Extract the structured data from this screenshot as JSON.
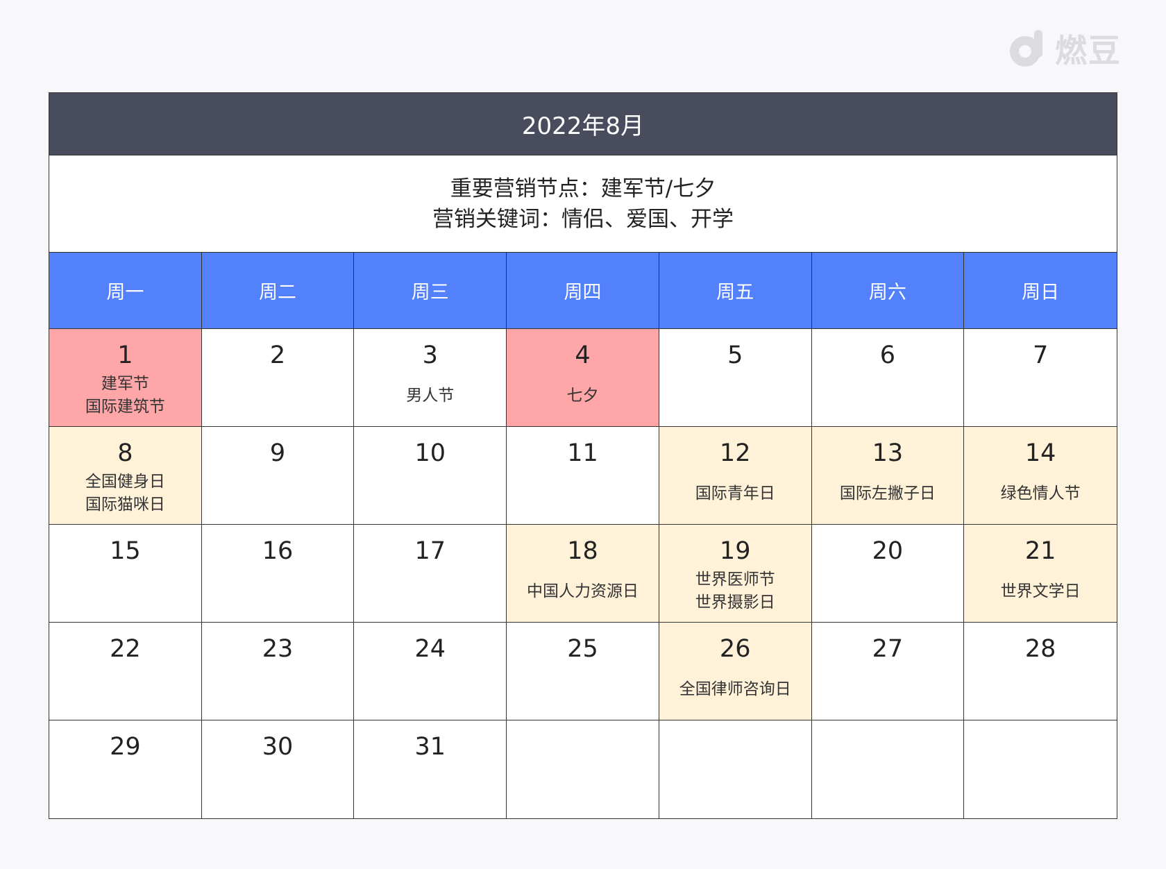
{
  "brand": {
    "name": "燃豆",
    "icon": "brand-d-icon"
  },
  "calendar": {
    "title": "2022年8月",
    "marketing": {
      "line1": "重要营销节点：建军节/七夕",
      "line2": "营销关键词：情侣、爱国、开学"
    },
    "weekdays": [
      "周一",
      "周二",
      "周三",
      "周四",
      "周五",
      "周六",
      "周日"
    ],
    "highlight_colors": {
      "major": "#ffa6a8",
      "minor": "#fff2d9",
      "header": "#494c5d",
      "weekday": "#5381fb"
    },
    "weeks": [
      [
        {
          "day": "1",
          "events": [
            "建军节",
            "国际建筑节"
          ],
          "highlight": "red"
        },
        {
          "day": "2",
          "events": [],
          "highlight": ""
        },
        {
          "day": "3",
          "events": [
            "男人节"
          ],
          "highlight": ""
        },
        {
          "day": "4",
          "events": [
            "七夕"
          ],
          "highlight": "red"
        },
        {
          "day": "5",
          "events": [],
          "highlight": ""
        },
        {
          "day": "6",
          "events": [],
          "highlight": ""
        },
        {
          "day": "7",
          "events": [],
          "highlight": ""
        }
      ],
      [
        {
          "day": "8",
          "events": [
            "全国健身日",
            "国际猫咪日"
          ],
          "highlight": "yellow"
        },
        {
          "day": "9",
          "events": [],
          "highlight": ""
        },
        {
          "day": "10",
          "events": [],
          "highlight": ""
        },
        {
          "day": "11",
          "events": [],
          "highlight": ""
        },
        {
          "day": "12",
          "events": [
            "国际青年日"
          ],
          "highlight": "yellow"
        },
        {
          "day": "13",
          "events": [
            "国际左撇子日"
          ],
          "highlight": "yellow"
        },
        {
          "day": "14",
          "events": [
            "绿色情人节"
          ],
          "highlight": "yellow"
        }
      ],
      [
        {
          "day": "15",
          "events": [],
          "highlight": ""
        },
        {
          "day": "16",
          "events": [],
          "highlight": ""
        },
        {
          "day": "17",
          "events": [],
          "highlight": ""
        },
        {
          "day": "18",
          "events": [
            "中国人力资源日"
          ],
          "highlight": "yellow"
        },
        {
          "day": "19",
          "events": [
            "世界医师节",
            "世界摄影日"
          ],
          "highlight": "yellow"
        },
        {
          "day": "20",
          "events": [],
          "highlight": ""
        },
        {
          "day": "21",
          "events": [
            "世界文学日"
          ],
          "highlight": "yellow"
        }
      ],
      [
        {
          "day": "22",
          "events": [],
          "highlight": ""
        },
        {
          "day": "23",
          "events": [],
          "highlight": ""
        },
        {
          "day": "24",
          "events": [],
          "highlight": ""
        },
        {
          "day": "25",
          "events": [],
          "highlight": ""
        },
        {
          "day": "26",
          "events": [
            "全国律师咨询日"
          ],
          "highlight": "yellow"
        },
        {
          "day": "27",
          "events": [],
          "highlight": ""
        },
        {
          "day": "28",
          "events": [],
          "highlight": ""
        }
      ],
      [
        {
          "day": "29",
          "events": [],
          "highlight": ""
        },
        {
          "day": "30",
          "events": [],
          "highlight": ""
        },
        {
          "day": "31",
          "events": [],
          "highlight": ""
        },
        {
          "day": "",
          "events": [],
          "highlight": ""
        },
        {
          "day": "",
          "events": [],
          "highlight": ""
        },
        {
          "day": "",
          "events": [],
          "highlight": ""
        },
        {
          "day": "",
          "events": [],
          "highlight": ""
        }
      ]
    ]
  }
}
